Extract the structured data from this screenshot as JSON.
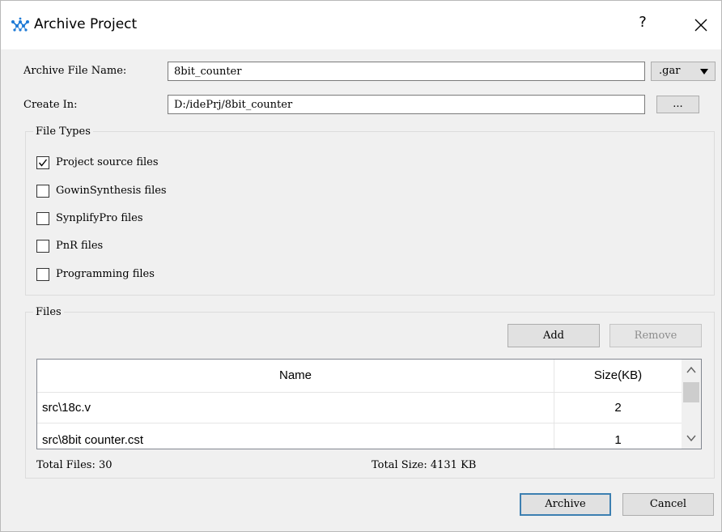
{
  "window": {
    "title": "Archive Project",
    "help_label": "?",
    "close_label": "×"
  },
  "form": {
    "archive_name_label": "Archive File Name:",
    "archive_name_value": "8bit_counter",
    "extension_value": ".gar",
    "create_in_label": "Create In:",
    "create_in_value": "D:/idePrj/8bit_counter",
    "browse_label": "..."
  },
  "file_types": {
    "group_title": "File Types",
    "options": [
      {
        "label": "Project source files",
        "checked": true
      },
      {
        "label": "GowinSynthesis files",
        "checked": false
      },
      {
        "label": "SynplifyPro files",
        "checked": false
      },
      {
        "label": "PnR files",
        "checked": false
      },
      {
        "label": "Programming files",
        "checked": false
      }
    ]
  },
  "files": {
    "group_title": "Files",
    "add_label": "Add",
    "remove_label": "Remove",
    "columns": [
      "Name",
      "Size(KB)"
    ],
    "rows": [
      {
        "name": "src\\18c.v",
        "size": "2"
      },
      {
        "name": "src\\8bit counter.cst",
        "size": "1"
      }
    ],
    "total_files_label": "Total Files: 30",
    "total_size_label": "Total Size: 4131 KB"
  },
  "footer": {
    "archive_label": "Archive",
    "cancel_label": "Cancel"
  },
  "icons": {
    "app": "gowin-logo-icon",
    "close": "close-icon",
    "dropdown": "chevron-down-icon",
    "scroll_up": "scroll-up-arrow-icon",
    "scroll_down": "scroll-down-arrow-icon",
    "check": "checkmark-icon"
  },
  "colors": {
    "logo_blue": "#1f7bd6",
    "default_button_border": "#3c7fb1",
    "dialog_bg": "#f0f0f0"
  }
}
